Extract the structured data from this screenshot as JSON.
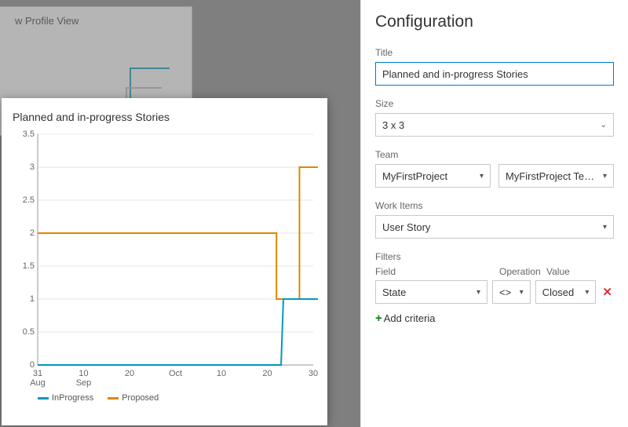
{
  "bg_tile": {
    "title": "w Profile View"
  },
  "preview": {
    "title": "Planned and in-progress Stories",
    "legend": {
      "inprogress_label": "InProgress",
      "proposed_label": "Proposed"
    }
  },
  "chart_data": {
    "type": "line",
    "xlabel": "",
    "ylabel": "",
    "ylim": [
      0,
      3.5
    ],
    "y_ticks": [
      0,
      0.5,
      1,
      1.5,
      2,
      2.5,
      3,
      3.5
    ],
    "x_ticks": [
      {
        "i": 0,
        "day": "31",
        "month": "Aug"
      },
      {
        "i": 1,
        "day": "10",
        "month": "Sep"
      },
      {
        "i": 2,
        "day": "20",
        "month": ""
      },
      {
        "i": 3,
        "day": "",
        "month": "Oct"
      },
      {
        "i": 4,
        "day": "10",
        "month": ""
      },
      {
        "i": 5,
        "day": "20",
        "month": ""
      },
      {
        "i": 6,
        "day": "30",
        "month": ""
      }
    ],
    "series": [
      {
        "name": "Proposed",
        "color": "#e08700",
        "points": [
          {
            "x": 0.0,
            "y": 2
          },
          {
            "x": 5.2,
            "y": 2
          },
          {
            "x": 5.2,
            "y": 1
          },
          {
            "x": 5.7,
            "y": 1
          },
          {
            "x": 5.7,
            "y": 3
          },
          {
            "x": 6.6,
            "y": 3
          }
        ]
      },
      {
        "name": "InProgress",
        "color": "#0099bc",
        "points": [
          {
            "x": 0.0,
            "y": 0
          },
          {
            "x": 5.3,
            "y": 0
          },
          {
            "x": 5.35,
            "y": 1
          },
          {
            "x": 6.6,
            "y": 1
          }
        ]
      }
    ]
  },
  "config": {
    "heading": "Configuration",
    "title_label": "Title",
    "title_value": "Planned and in-progress Stories",
    "size_label": "Size",
    "size_value": "3 x 3",
    "team_label": "Team",
    "team_project": "MyFirstProject",
    "team_name": "MyFirstProject Team",
    "work_items_label": "Work Items",
    "work_items_value": "User Story",
    "filters_label": "Filters",
    "filters_cols": {
      "field": "Field",
      "operation": "Operation",
      "value": "Value"
    },
    "filter_row": {
      "field": "State",
      "operation": "<>",
      "value": "Closed"
    },
    "add_criteria_label": "Add criteria"
  },
  "colors": {
    "primary": "#0078d4",
    "danger": "#d13438",
    "success": "#107c10"
  }
}
